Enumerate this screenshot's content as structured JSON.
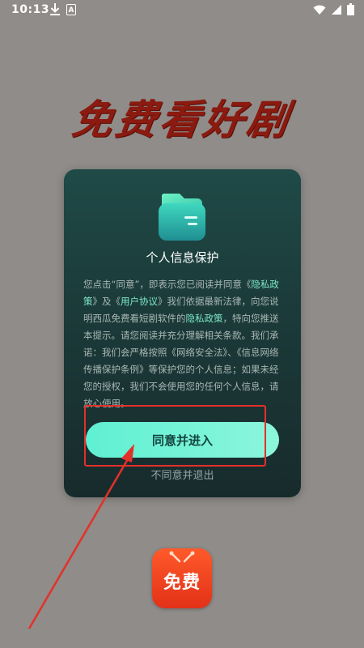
{
  "status_bar": {
    "time": "10:13",
    "a_badge": "A"
  },
  "brand": {
    "headline": "免费看好剧",
    "logo_text": "免费"
  },
  "dialog": {
    "title": "个人信息保护",
    "body": [
      {
        "text": "您点击“同意”，即表示您已阅读并同意《",
        "link": false
      },
      {
        "text": "隐私政策",
        "link": true
      },
      {
        "text": "》及《",
        "link": false
      },
      {
        "text": "用户协议",
        "link": true
      },
      {
        "text": "》我们依据最新法律，向您说明西瓜免费看短剧软件的",
        "link": false
      },
      {
        "text": "隐私政策",
        "link": true
      },
      {
        "text": "，特向您推送本提示。请您阅读并充分理解相关条款。我们承诺：我们会严格按照《网络安全法》、《信息网络传播保护条例》等保护您的个人信息；如果未经您的授权，我们不会使用您的任何个人信息，请放心使用。",
        "link": false
      }
    ],
    "agree_label": "同意并进入",
    "exit_label": "不同意并退出"
  },
  "colors": {
    "background": "#8f8c89",
    "accent": "#5ff0d2",
    "link": "#7ee8c8",
    "annotation": "#e4302a",
    "headline": "#8b1a10"
  }
}
